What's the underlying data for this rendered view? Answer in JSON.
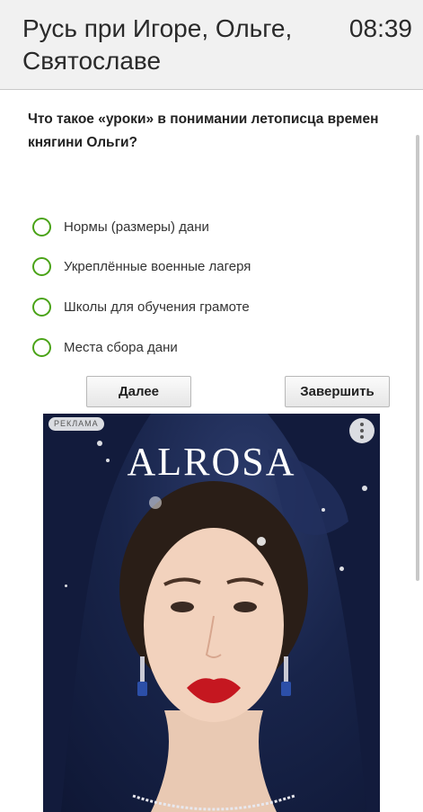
{
  "header": {
    "title": "Русь при Игоре, Ольге, Святославе",
    "timer": "08:39"
  },
  "question": {
    "text": "Что такое «уроки» в понимании летописца времен княгини Ольги?"
  },
  "options": [
    {
      "label": "Нормы (размеры) дани"
    },
    {
      "label": "Укреплённые военные лагеря"
    },
    {
      "label": "Школы для обучения грамоте"
    },
    {
      "label": "Места сбора дани"
    }
  ],
  "buttons": {
    "next_label": "Далее",
    "finish_label": "Завершить"
  },
  "ad": {
    "badge": "РЕКЛАМА",
    "brand": "ALROSA",
    "menu_icon": "more-vertical-icon"
  },
  "colors": {
    "radio_border": "#4aa317",
    "header_bg": "#f1f1f1",
    "ad_bg": "#18244a"
  }
}
